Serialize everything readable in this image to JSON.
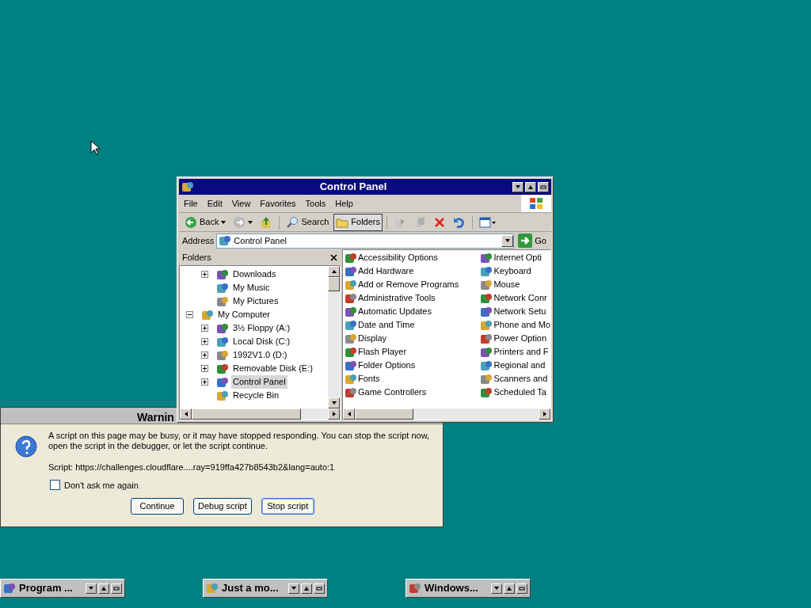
{
  "warning_dialog": {
    "title": "Warnin",
    "message": "A script on this page may be busy, or it may have stopped responding. You can stop the script now, open the script in the debugger, or let the script continue.",
    "script": "Script: https://challenges.cloudflare....ray=919ffa427b8543b2&lang=auto:1",
    "checkbox": {
      "label": "Don't ask me again",
      "checked": false
    },
    "buttons": [
      {
        "label": "Continue",
        "default": false
      },
      {
        "label": "Debug script",
        "default": false
      },
      {
        "label": "Stop script",
        "default": true
      }
    ]
  },
  "control_panel": {
    "title": "Control Panel",
    "menu": [
      "File",
      "Edit",
      "View",
      "Favorites",
      "Tools",
      "Help"
    ],
    "toolbar": [
      {
        "kind": "back",
        "label": "Back"
      },
      {
        "kind": "forward"
      },
      {
        "kind": "up"
      },
      {
        "kind": "search",
        "label": "Search"
      },
      {
        "kind": "folders",
        "label": "Folders",
        "selected": true
      },
      {
        "kind": "move"
      },
      {
        "kind": "copy"
      },
      {
        "kind": "delete"
      },
      {
        "kind": "undo"
      },
      {
        "kind": "views"
      }
    ],
    "address": {
      "label": "Address",
      "value": "Control Panel",
      "go": "Go"
    },
    "folders": {
      "title": "Folders",
      "tree": [
        {
          "children": [
            {
              "label": "Downloads",
              "has_children": true,
              "expanded": false,
              "selected": false
            },
            {
              "label": "My Music",
              "has_children": false,
              "selected": false
            },
            {
              "label": "My Pictures",
              "has_children": false,
              "selected": false
            }
          ]
        },
        {
          "label": "My Computer",
          "has_children": true,
          "expanded": true,
          "selected": false,
          "children": [
            {
              "label": "3½ Floppy (A:)",
              "has_children": true,
              "expanded": false,
              "selected": false
            },
            {
              "label": "Local Disk (C:)",
              "has_children": true,
              "expanded": false,
              "selected": false
            },
            {
              "label": "1992V1.0 (D:)",
              "has_children": true,
              "expanded": false,
              "selected": false
            },
            {
              "label": "Removable Disk (E:)",
              "has_children": true,
              "expanded": false,
              "selected": false
            },
            {
              "label": "Control Panel",
              "has_children": true,
              "expanded": false,
              "selected": true
            },
            {
              "label": "Recycle Bin",
              "has_children": false,
              "selected": false
            }
          ]
        }
      ]
    },
    "items": [
      [
        "Accessibility Options",
        "Add Hardware",
        "Add or Remove Programs",
        "Administrative Tools",
        "Automatic Updates",
        "Date and Time",
        "Display",
        "Flash Player",
        "Folder Options",
        "Fonts",
        "Game Controllers"
      ],
      [
        "Internet Opti",
        "Keyboard",
        "Mouse",
        "Network Conr",
        "Network Setu",
        "Phone and Mo",
        "Power Option",
        "Printers and F",
        "Regional and",
        "Scanners and",
        "Scheduled Ta"
      ]
    ]
  },
  "taskbar": [
    {
      "label": "Program ..."
    },
    {
      "label": "Just a mo..."
    },
    {
      "label": "Windows..."
    }
  ]
}
